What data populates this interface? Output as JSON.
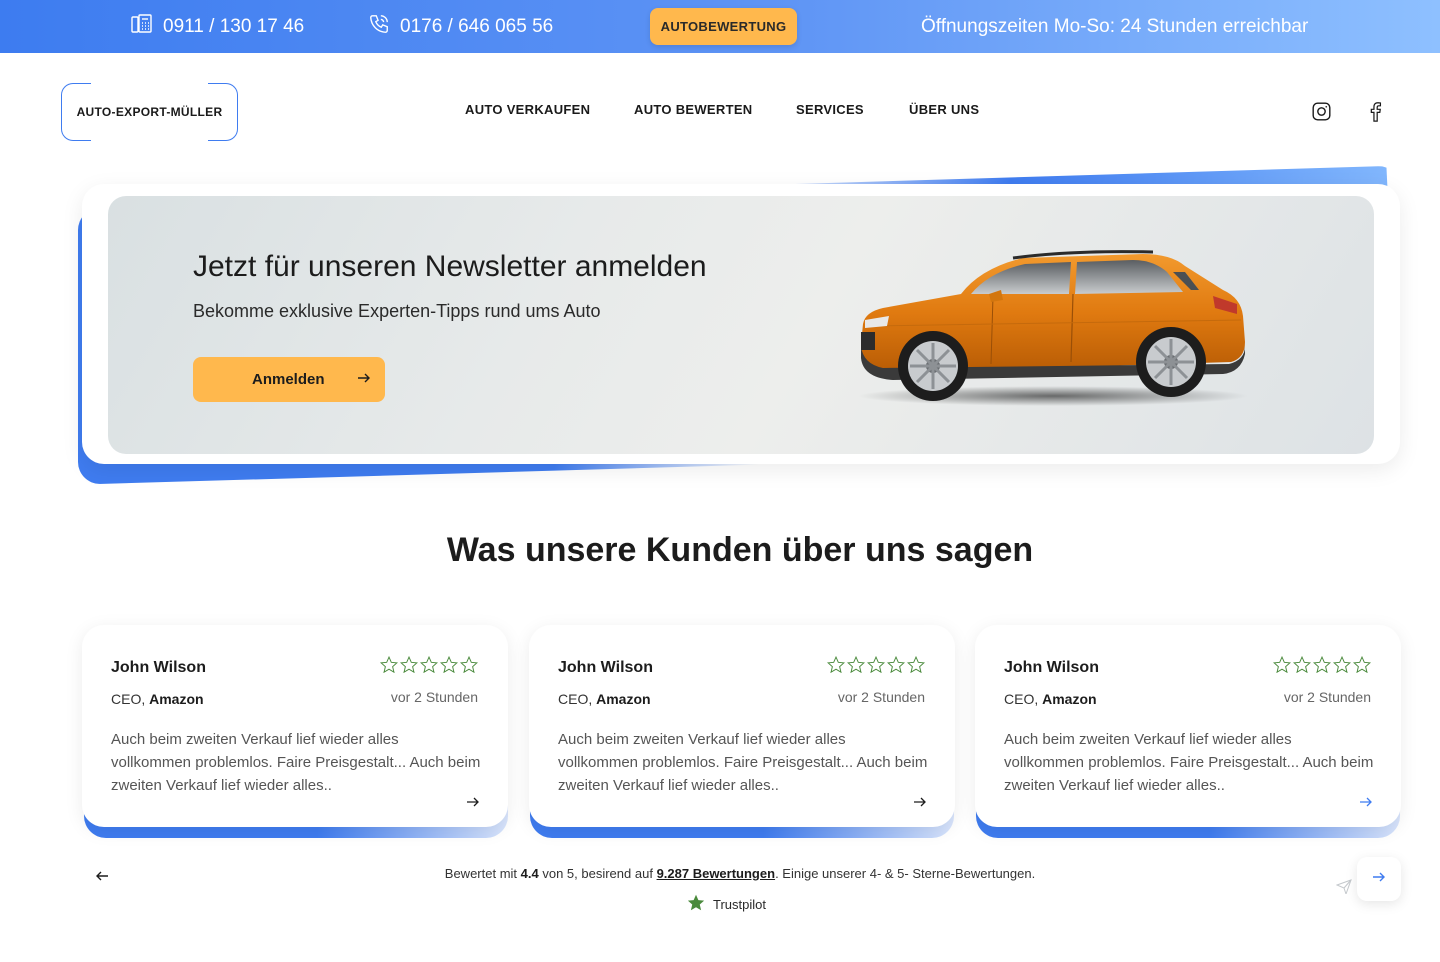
{
  "topbar": {
    "phone1": "0911 / 130 17 46",
    "phone1_icon": "fax-icon",
    "phone2": "0176 / 646 065 56",
    "phone2_icon": "phone-icon",
    "cta_label": "AUTOBEWERTUNG",
    "hours": "Öffnungszeiten Mo-So: 24 Stunden erreichbar",
    "gradient_start": "#3d7cf0",
    "gradient_end": "#8ec0ff",
    "cta_color": "#ffb84d"
  },
  "header": {
    "logo_text": "AUTO-EXPORT-MÜLLER",
    "nav": [
      "AUTO VERKAUFEN",
      "AUTO BEWERTEN",
      "SERVICES",
      "ÜBER UNS"
    ],
    "social": [
      "instagram-icon",
      "facebook-icon"
    ]
  },
  "newsletter": {
    "title": "Jetzt für unseren Newsletter anmelden",
    "subtitle": "Bekomme exklusive Experten-Tipps rund ums Auto",
    "button_label": "Anmelden",
    "image": "orange-suv-image"
  },
  "reviews": {
    "title": "Was unsere Kunden über uns sagen",
    "items": [
      {
        "name": "John Wilson",
        "role": "CEO,",
        "company": "Amazon",
        "time": "vor 2 Stunden",
        "stars": 5,
        "text": "Auch beim zweiten Verkauf lief wieder alles vollkommen problemlos. Faire Preisgestalt... Auch beim zweiten Verkauf lief wieder alles.."
      },
      {
        "name": "John Wilson",
        "role": "CEO,",
        "company": "Amazon",
        "time": "vor 2 Stunden",
        "stars": 5,
        "text": "Auch beim zweiten Verkauf lief wieder alles vollkommen problemlos. Faire Preisgestalt... Auch beim zweiten Verkauf lief wieder alles.."
      },
      {
        "name": "John Wilson",
        "role": "CEO,",
        "company": "Amazon",
        "time": "vor 2 Stunden",
        "stars": 5,
        "text": "Auch beim zweiten Verkauf lief wieder alles vollkommen problemlos. Faire Preisgestalt... Auch beim zweiten Verkauf lief wieder alles.."
      }
    ],
    "rating_prefix": "Bewertet mit",
    "rating_value": "4.4",
    "rating_mid": "von 5, besirend auf",
    "rating_count": "9.287 Bewertungen",
    "rating_suffix": ". Einige unserer 4- & 5- Sterne-Bewertungen.",
    "trustpilot_label": "Trustpilot",
    "star_color": "#4a8a3c",
    "accent": "#3f7cf0"
  }
}
